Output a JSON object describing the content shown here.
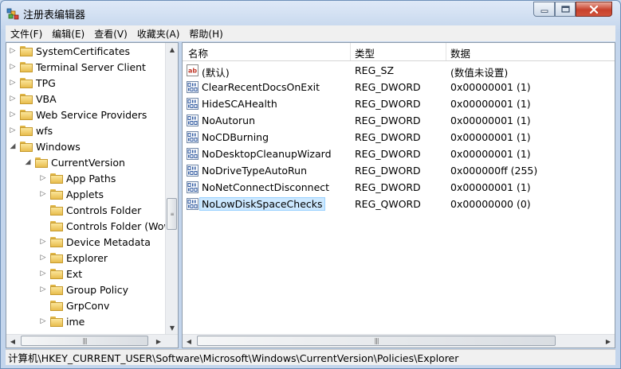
{
  "window": {
    "title": "注册表编辑器"
  },
  "menu": [
    "文件(F)",
    "编辑(E)",
    "查看(V)",
    "收藏夹(A)",
    "帮助(H)"
  ],
  "tree": [
    {
      "label": "SystemCertificates",
      "level": 0,
      "expander": "▷"
    },
    {
      "label": "Terminal Server Client",
      "level": 0,
      "expander": "▷"
    },
    {
      "label": "TPG",
      "level": 0,
      "expander": "▷"
    },
    {
      "label": "VBA",
      "level": 0,
      "expander": "▷"
    },
    {
      "label": "Web Service Providers",
      "level": 0,
      "expander": "▷"
    },
    {
      "label": "wfs",
      "level": 0,
      "expander": "▷"
    },
    {
      "label": "Windows",
      "level": 0,
      "expander": "◢"
    },
    {
      "label": "CurrentVersion",
      "level": 1,
      "expander": "◢"
    },
    {
      "label": "App Paths",
      "level": 2,
      "expander": "▷"
    },
    {
      "label": "Applets",
      "level": 2,
      "expander": "▷"
    },
    {
      "label": "Controls Folder",
      "level": 2,
      "expander": ""
    },
    {
      "label": "Controls Folder (Wow",
      "level": 2,
      "expander": ""
    },
    {
      "label": "Device Metadata",
      "level": 2,
      "expander": "▷"
    },
    {
      "label": "Explorer",
      "level": 2,
      "expander": "▷"
    },
    {
      "label": "Ext",
      "level": 2,
      "expander": "▷"
    },
    {
      "label": "Group Policy",
      "level": 2,
      "expander": "▷"
    },
    {
      "label": "GrpConv",
      "level": 2,
      "expander": ""
    },
    {
      "label": "ime",
      "level": 2,
      "expander": "▷"
    }
  ],
  "columns": {
    "name": "名称",
    "type": "类型",
    "data": "数据"
  },
  "values": [
    {
      "icon": "string",
      "name": "(默认)",
      "type": "REG_SZ",
      "data": "(数值未设置)"
    },
    {
      "icon": "binary",
      "name": "ClearRecentDocsOnExit",
      "type": "REG_DWORD",
      "data": "0x00000001 (1)"
    },
    {
      "icon": "binary",
      "name": "HideSCAHealth",
      "type": "REG_DWORD",
      "data": "0x00000001 (1)"
    },
    {
      "icon": "binary",
      "name": "NoAutorun",
      "type": "REG_DWORD",
      "data": "0x00000001 (1)"
    },
    {
      "icon": "binary",
      "name": "NoCDBurning",
      "type": "REG_DWORD",
      "data": "0x00000001 (1)"
    },
    {
      "icon": "binary",
      "name": "NoDesktopCleanupWizard",
      "type": "REG_DWORD",
      "data": "0x00000001 (1)"
    },
    {
      "icon": "binary",
      "name": "NoDriveTypeAutoRun",
      "type": "REG_DWORD",
      "data": "0x000000ff (255)"
    },
    {
      "icon": "binary",
      "name": "NoNetConnectDisconnect",
      "type": "REG_DWORD",
      "data": "0x00000001 (1)"
    },
    {
      "icon": "binary",
      "name": "NoLowDiskSpaceChecks",
      "type": "REG_QWORD",
      "data": "0x00000000 (0)",
      "selected": true
    }
  ],
  "status": {
    "path": "计算机\\HKEY_CURRENT_USER\\Software\\Microsoft\\Windows\\CurrentVersion\\Policies\\Explorer"
  },
  "icons": {
    "app": "registry-editor-icon",
    "minimize": "minimize-icon",
    "maximize": "maximize-icon",
    "close": "close-icon"
  }
}
